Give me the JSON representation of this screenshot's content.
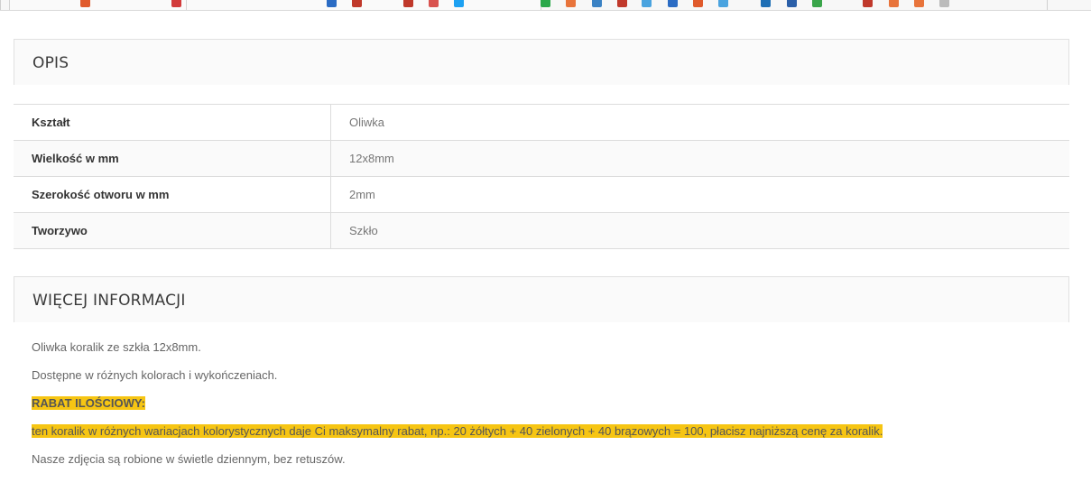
{
  "colors": {
    "highlight": "#f6c513",
    "heading": "#3a3a3a",
    "text": "#666666"
  },
  "description": {
    "title": "OPIS",
    "specs": [
      {
        "label": "Kształt",
        "value": "Oliwka"
      },
      {
        "label": "Wielkość w mm",
        "value": "12x8mm"
      },
      {
        "label": "Szerokość otworu w mm",
        "value": "2mm"
      },
      {
        "label": "Tworzywo",
        "value": "Szkło"
      }
    ]
  },
  "more_info": {
    "title": "WIĘCEJ INFORMACJI",
    "p1": "Oliwka koralik ze szkła 12x8mm.",
    "p2": "Dostępne w różnych kolorach i wykończeniach.",
    "discount_heading": "RABAT ILOŚCIOWY:",
    "discount_text": "ten koralik w różnych wariacjach kolorystycznych daje Ci maksymalny rabat, np.: 20 żółtych + 40 zielonych + 40 brązowych = 100, płacisz najniższą cenę za koralik.",
    "p3": "Nasze zdjęcia są robione w świetle dziennym, bez retuszów."
  }
}
